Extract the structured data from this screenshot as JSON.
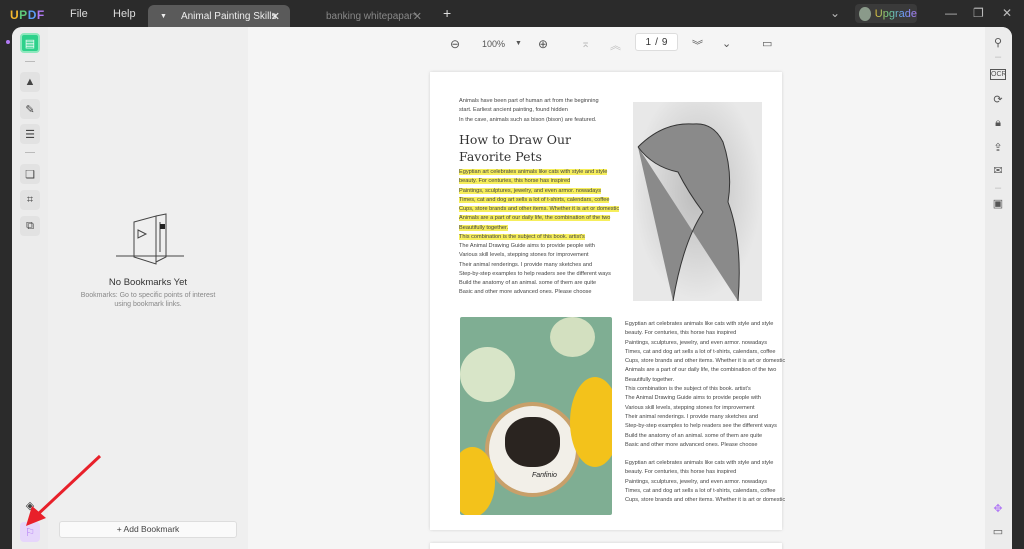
{
  "titlebar": {
    "logo": "UPDF",
    "menu": [
      "File",
      "Help"
    ],
    "tabs": [
      {
        "label": "Animal Painting Skills",
        "active": true
      },
      {
        "label": "banking whitepapar*",
        "active": false
      }
    ],
    "new_tab": "+",
    "upgrade": "Upgrade"
  },
  "toolbar": {
    "zoom": "100%",
    "page_current": "1",
    "page_total": "9",
    "page_sep": "/"
  },
  "bookmarks": {
    "empty_title": "No Bookmarks Yet",
    "empty_desc_1": "Bookmarks: Go to specific points of interest",
    "empty_desc_2": "using bookmark links.",
    "add_button": "+ Add Bookmark"
  },
  "document": {
    "intro": [
      "Animals have been part of human art from the beginning",
      "start. Earliest ancient painting, found hidden",
      "In the cave, animals such as bison (bison) are featured."
    ],
    "heading": [
      "How to Draw Our",
      "Favorite Pets"
    ],
    "highlighted": [
      "Egyptian art celebrates animals like cats with style and style",
      "beauty. For centuries, this horse has inspired",
      "Paintings, sculptures, jewelry, and even armor. nowadays",
      "Times, cat and dog art sells a lot of t-shirts, calendars, coffee",
      "Cups, store brands and other items. Whether it is art or domestic",
      "Animals are a part of our daily life, the combination of the two",
      "Beautifully together.",
      "This combination is the subject of this book. artist's"
    ],
    "body": [
      "The Animal Drawing Guide aims to provide people with",
      "Various skill levels, stepping stones for improvement",
      "Their animal renderings. I provide many sketches and",
      "Step-by-step examples to help readers see the different ways",
      "Build the anatomy of an animal. some of them are quite",
      "Basic and other more advanced ones. Please choose"
    ],
    "right_col": [
      "Egyptian art celebrates animals like cats with style and style",
      "beauty. For centuries, this horse has inspired",
      "Paintings, sculptures, jewelry, and even armor. nowadays",
      "Times, cat and dog art sells a lot of t-shirts, calendars, coffee",
      "Cups, store brands and other items. Whether it is art or domestic",
      "Animals are a part of our daily life, the combination of the two",
      "Beautifully together.",
      "This combination is the subject of this book. artist's",
      "The Animal Drawing Guide aims to provide people with",
      "Various skill levels, stepping stones for improvement",
      "Their animal renderings. I provide many sketches and",
      "Step-by-step examples to help readers see the different ways",
      "Build the anatomy of an animal. some of them are quite",
      "Basic and other more advanced ones. Please choose"
    ],
    "right_col2": [
      "Egyptian art celebrates animals like cats with style and style",
      "beauty. For centuries, this horse has inspired",
      "Paintings, sculptures, jewelry, and even armor. nowadays",
      "Times, cat and dog art sells a lot of t-shirts, calendars, coffee",
      "Cups, store brands and other items. Whether it is art or domestic"
    ],
    "embroidery_text": "Fanfinio"
  },
  "colors": {
    "accent": "#b27af5",
    "highlight": "#f6ee5c",
    "arrow": "#e8202a"
  }
}
